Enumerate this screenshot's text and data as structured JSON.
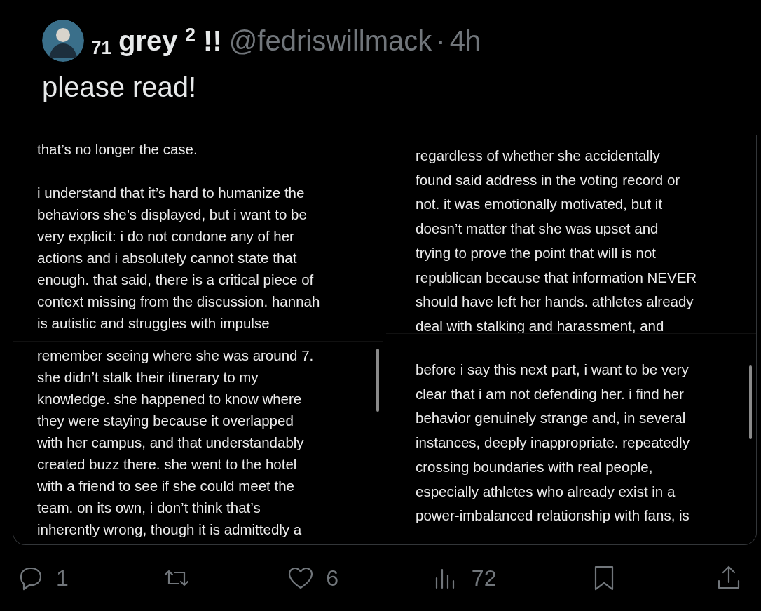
{
  "author": {
    "name_prefix": "71",
    "name": "grey $^{2}$ !!",
    "handle": "@fedriswillmack",
    "separator": "·",
    "time": "4h"
  },
  "text": "please read!",
  "columns": [
    {
      "images": [
        {
          "paragraphs": [
            [
              "that’s no longer the case."
            ],
            [
              "i understand that it’s hard to humanize the",
              "behaviors she’s displayed, but i want to be",
              "very explicit: i do not condone any of her",
              "actions and i absolutely cannot state that",
              "enough. that said, there is a critical piece of",
              "context missing from the discussion. hannah",
              "is autistic and struggles with impulse"
            ]
          ]
        },
        {
          "scroll": true,
          "paragraphs": [
            [
              "remember seeing where she was around 7.",
              "she didn’t stalk their itinerary to my",
              "knowledge. she happened to know where",
              "they were staying because it overlapped",
              "with her campus, and that understandably",
              "created buzz there. she went to the hotel",
              "with a friend to see if she could meet the",
              "team. on its own, i don’t think that’s",
              "inherently wrong, though it is admittedly a"
            ]
          ]
        }
      ]
    },
    {
      "images": [
        {
          "paragraphs": [
            [
              "regardless of whether she accidentally",
              "found said address in the voting record or",
              "not. it was emotionally motivated, but it",
              "doesn’t matter that she was upset and",
              "trying to prove the point that will is not",
              "republican because that information NEVER",
              "should have left her hands. athletes already",
              "deal with stalking and harassment, and"
            ]
          ]
        },
        {
          "scroll": true,
          "paragraphs": [
            [
              "before i say this next part, i want to be very",
              "clear that i am not defending her. i find her",
              "behavior genuinely strange and, in several",
              "instances, deeply inappropriate. repeatedly",
              "crossing boundaries with real people,",
              "especially athletes who already exist in a",
              "power-imbalanced relationship with fans, is"
            ]
          ]
        }
      ]
    }
  ],
  "actions": [
    {
      "kind": "reply",
      "count": "1"
    },
    {
      "kind": "repost"
    },
    {
      "kind": "like",
      "count": "6"
    },
    {
      "kind": "views",
      "count": "72"
    },
    {
      "kind": "bookmark"
    },
    {
      "kind": "share"
    }
  ]
}
